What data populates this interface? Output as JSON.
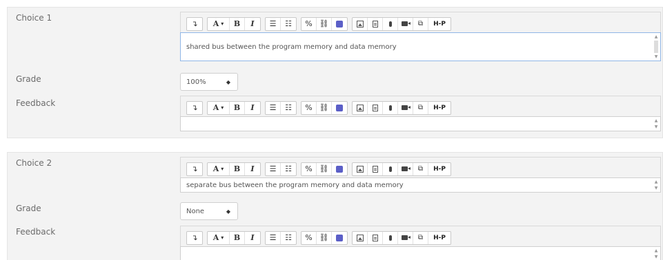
{
  "toolbar": {
    "undo": "↴",
    "font": "A",
    "font_caret": "▾",
    "bold": "B",
    "italic": "I",
    "ul": "☰",
    "ol": "☷",
    "link": "%",
    "unlink": "⛓",
    "h5p": "H-P"
  },
  "choices": [
    {
      "label": "Choice 1",
      "answer": "shared bus between the program memory and data memory",
      "grade_label": "Grade",
      "grade": "100%",
      "feedback_label": "Feedback",
      "feedback": ""
    },
    {
      "label": "Choice 2",
      "answer": "separate bus between the program memory and data memory",
      "grade_label": "Grade",
      "grade": "None",
      "feedback_label": "Feedback",
      "feedback": ""
    }
  ],
  "icons": [
    "undo-icon",
    "font-icon",
    "bold-icon",
    "italic-icon",
    "unordered-list-icon",
    "ordered-list-icon",
    "link-icon",
    "unlink-icon",
    "teams-icon",
    "image-icon",
    "media-file-icon",
    "microphone-icon",
    "video-icon",
    "manage-files-icon",
    "h5p-icon"
  ],
  "colors": {
    "accent": "#5b5fc7",
    "focus_border": "#8fb6e6",
    "panel": "#f3f3f3"
  }
}
